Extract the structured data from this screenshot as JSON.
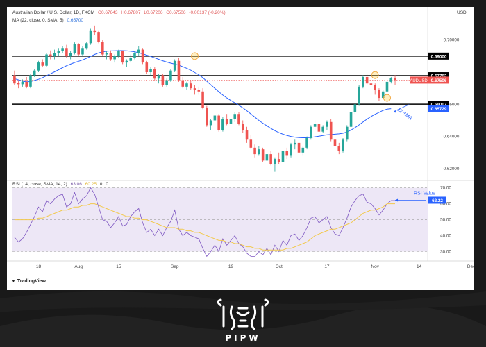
{
  "header": {
    "symbol": "Australian Dollar / U.S. Dollar, 1D, FXCM",
    "o": "O0.67643",
    "h": "H0.67807",
    "l": "L0.67206",
    "c": "C0.67506",
    "chg": "-0.00137 (-0.20%)",
    "ma_label": "MA (22, close, 0, SMA, 5)",
    "ma_value": "0.65700",
    "rsi_label": "RSI (14, close, SMA, 14, 2)",
    "rsi_value": "63.06",
    "rsi_ma_value": "60.25",
    "rsi_extra1": "0",
    "rsi_extra2": "0",
    "currency": "USD"
  },
  "colors": {
    "up": "#26a69a",
    "down": "#ef5350",
    "sma": "#2962ff",
    "rsi": "#7e57c2",
    "rsi_ma": "#f2c94c",
    "rsi_band": "#ede7f6",
    "label_black": "#000000",
    "label_red": "#ef5350",
    "label_blue": "#2962ff"
  },
  "footer": {
    "tradingview": "TradingView",
    "brand": "PIPW"
  },
  "chart_data": [
    {
      "type": "candlestick",
      "title": "Australian Dollar / U.S. Dollar, 1D, FXCM",
      "ylim": [
        0.6135,
        0.7085
      ],
      "y_ticks": [
        "0.70000",
        "0.66000",
        "0.64000",
        "0.62000"
      ],
      "x_ticks": [
        "18",
        "Aug",
        "15",
        "Sep",
        "19",
        "Oct",
        "17",
        "Nov",
        "14",
        "Dec"
      ],
      "levels": [
        {
          "value": 0.69,
          "label": "0.69000",
          "style": "black"
        },
        {
          "value": 0.67782,
          "label": "0.67782",
          "style": "black"
        },
        {
          "value": 0.66007,
          "label": "0.66007",
          "style": "black"
        }
      ],
      "price_label": {
        "value": 0.67506,
        "label": "0.67506",
        "name": "AUDUSD"
      },
      "sma_label": {
        "value": 0.65729,
        "label": "0.65729",
        "annotation": "22 SMA"
      },
      "candles": [
        [
          0.678,
          0.681,
          0.672,
          0.673
        ],
        [
          0.6735,
          0.6745,
          0.67,
          0.6725
        ],
        [
          0.6725,
          0.6755,
          0.671,
          0.674
        ],
        [
          0.674,
          0.677,
          0.67,
          0.671
        ],
        [
          0.671,
          0.679,
          0.67,
          0.678
        ],
        [
          0.678,
          0.682,
          0.677,
          0.681
        ],
        [
          0.681,
          0.687,
          0.68,
          0.686
        ],
        [
          0.686,
          0.688,
          0.683,
          0.684
        ],
        [
          0.684,
          0.692,
          0.683,
          0.691
        ],
        [
          0.691,
          0.6935,
          0.688,
          0.69
        ],
        [
          0.69,
          0.694,
          0.688,
          0.692
        ],
        [
          0.692,
          0.695,
          0.69,
          0.693
        ],
        [
          0.693,
          0.696,
          0.692,
          0.695
        ],
        [
          0.695,
          0.697,
          0.689,
          0.69
        ],
        [
          0.69,
          0.693,
          0.688,
          0.692
        ],
        [
          0.692,
          0.6985,
          0.691,
          0.6975
        ],
        [
          0.6975,
          0.698,
          0.69,
          0.691
        ],
        [
          0.691,
          0.696,
          0.69,
          0.695
        ],
        [
          0.695,
          0.699,
          0.694,
          0.698
        ],
        [
          0.698,
          0.707,
          0.697,
          0.706
        ],
        [
          0.706,
          0.709,
          0.703,
          0.705
        ],
        [
          0.705,
          0.706,
          0.698,
          0.699
        ],
        [
          0.699,
          0.7,
          0.69,
          0.691
        ],
        [
          0.691,
          0.693,
          0.688,
          0.692
        ],
        [
          0.692,
          0.6935,
          0.687,
          0.688
        ],
        [
          0.688,
          0.691,
          0.686,
          0.69
        ],
        [
          0.69,
          0.694,
          0.689,
          0.693
        ],
        [
          0.693,
          0.6935,
          0.685,
          0.686
        ],
        [
          0.686,
          0.688,
          0.683,
          0.687
        ],
        [
          0.687,
          0.691,
          0.686,
          0.689
        ],
        [
          0.689,
          0.693,
          0.688,
          0.692
        ],
        [
          0.692,
          0.696,
          0.69,
          0.694
        ],
        [
          0.694,
          0.695,
          0.685,
          0.686
        ],
        [
          0.686,
          0.687,
          0.679,
          0.68
        ],
        [
          0.68,
          0.683,
          0.678,
          0.682
        ],
        [
          0.682,
          0.683,
          0.675,
          0.676
        ],
        [
          0.676,
          0.679,
          0.673,
          0.678
        ],
        [
          0.678,
          0.679,
          0.671,
          0.672
        ],
        [
          0.672,
          0.676,
          0.671,
          0.675
        ],
        [
          0.675,
          0.682,
          0.674,
          0.681
        ],
        [
          0.681,
          0.688,
          0.68,
          0.687
        ],
        [
          0.687,
          0.689,
          0.674,
          0.675
        ],
        [
          0.675,
          0.677,
          0.67,
          0.671
        ],
        [
          0.671,
          0.674,
          0.669,
          0.673
        ],
        [
          0.673,
          0.675,
          0.669,
          0.67
        ],
        [
          0.67,
          0.672,
          0.666,
          0.669
        ],
        [
          0.669,
          0.671,
          0.666,
          0.668
        ],
        [
          0.668,
          0.67,
          0.657,
          0.658
        ],
        [
          0.658,
          0.659,
          0.646,
          0.647
        ],
        [
          0.647,
          0.651,
          0.644,
          0.65
        ],
        [
          0.65,
          0.654,
          0.648,
          0.653
        ],
        [
          0.653,
          0.654,
          0.643,
          0.644
        ],
        [
          0.644,
          0.652,
          0.643,
          0.651
        ],
        [
          0.651,
          0.654,
          0.647,
          0.648
        ],
        [
          0.648,
          0.652,
          0.646,
          0.651
        ],
        [
          0.651,
          0.655,
          0.649,
          0.654
        ],
        [
          0.654,
          0.655,
          0.647,
          0.648
        ],
        [
          0.648,
          0.65,
          0.642,
          0.644
        ],
        [
          0.644,
          0.646,
          0.636,
          0.638
        ],
        [
          0.638,
          0.641,
          0.632,
          0.633
        ],
        [
          0.633,
          0.635,
          0.627,
          0.629
        ],
        [
          0.629,
          0.634,
          0.628,
          0.632
        ],
        [
          0.632,
          0.633,
          0.624,
          0.625
        ],
        [
          0.625,
          0.63,
          0.623,
          0.629
        ],
        [
          0.629,
          0.631,
          0.622,
          0.623
        ],
        [
          0.623,
          0.627,
          0.618,
          0.626
        ],
        [
          0.626,
          0.63,
          0.623,
          0.624
        ],
        [
          0.624,
          0.632,
          0.623,
          0.631
        ],
        [
          0.631,
          0.633,
          0.626,
          0.628
        ],
        [
          0.628,
          0.636,
          0.627,
          0.635
        ],
        [
          0.635,
          0.638,
          0.632,
          0.636
        ],
        [
          0.636,
          0.637,
          0.629,
          0.63
        ],
        [
          0.63,
          0.634,
          0.628,
          0.633
        ],
        [
          0.633,
          0.64,
          0.632,
          0.639
        ],
        [
          0.639,
          0.647,
          0.638,
          0.646
        ],
        [
          0.646,
          0.65,
          0.644,
          0.648
        ],
        [
          0.648,
          0.649,
          0.642,
          0.643
        ],
        [
          0.643,
          0.647,
          0.642,
          0.646
        ],
        [
          0.646,
          0.65,
          0.644,
          0.649
        ],
        [
          0.649,
          0.651,
          0.637,
          0.638
        ],
        [
          0.638,
          0.64,
          0.633,
          0.634
        ],
        [
          0.634,
          0.636,
          0.629,
          0.631
        ],
        [
          0.631,
          0.639,
          0.63,
          0.638
        ],
        [
          0.638,
          0.647,
          0.637,
          0.646
        ],
        [
          0.646,
          0.656,
          0.645,
          0.655
        ],
        [
          0.655,
          0.661,
          0.654,
          0.66
        ],
        [
          0.66,
          0.672,
          0.659,
          0.671
        ],
        [
          0.671,
          0.678,
          0.67,
          0.677
        ],
        [
          0.677,
          0.679,
          0.672,
          0.673
        ],
        [
          0.673,
          0.674,
          0.668,
          0.672
        ],
        [
          0.672,
          0.673,
          0.666,
          0.669
        ],
        [
          0.669,
          0.67,
          0.662,
          0.664
        ],
        [
          0.664,
          0.669,
          0.663,
          0.668
        ],
        [
          0.668,
          0.675,
          0.667,
          0.674
        ],
        [
          0.674,
          0.677,
          0.673,
          0.6765
        ],
        [
          0.6765,
          0.6781,
          0.6721,
          0.6751
        ]
      ],
      "sma": [
        0.676,
        0.6752,
        0.6744,
        0.674,
        0.6742,
        0.6748,
        0.6756,
        0.6766,
        0.6778,
        0.679,
        0.6802,
        0.6815,
        0.6828,
        0.684,
        0.685,
        0.686,
        0.6868,
        0.6876,
        0.6886,
        0.6898,
        0.691,
        0.692,
        0.6926,
        0.693,
        0.6932,
        0.6933,
        0.6934,
        0.6934,
        0.6933,
        0.693,
        0.6926,
        0.6921,
        0.6914,
        0.6906,
        0.6898,
        0.6889,
        0.688,
        0.6871,
        0.6863,
        0.6856,
        0.685,
        0.6843,
        0.6834,
        0.6824,
        0.6812,
        0.6798,
        0.6784,
        0.6766,
        0.6744,
        0.6722,
        0.67,
        0.6678,
        0.6658,
        0.664,
        0.6624,
        0.6609,
        0.6594,
        0.6578,
        0.656,
        0.654,
        0.652,
        0.65,
        0.6482,
        0.6466,
        0.645,
        0.6436,
        0.6424,
        0.6414,
        0.6406,
        0.64,
        0.6396,
        0.6393,
        0.6392,
        0.6392,
        0.6394,
        0.6398,
        0.6402,
        0.6406,
        0.641,
        0.6412,
        0.6414,
        0.6416,
        0.642,
        0.6428,
        0.644,
        0.6455,
        0.6472,
        0.649,
        0.6508,
        0.6524,
        0.6538,
        0.655,
        0.6562,
        0.657,
        0.6573
      ]
    },
    {
      "type": "line",
      "title": "RSI (14, close, SMA, 14, 2)",
      "ylim": [
        25,
        72
      ],
      "y_ticks": [
        "70.00",
        "60.00",
        "50.00",
        "40.00",
        "30.00"
      ],
      "band": [
        30,
        70
      ],
      "midline": 50,
      "rsi_label": {
        "value": 62.22,
        "label": "62.22",
        "annotation": "RSI Value"
      },
      "series": [
        {
          "name": "RSI",
          "values": [
            39,
            36,
            38,
            42,
            47,
            52,
            58,
            55,
            62,
            60,
            63,
            65,
            66,
            58,
            60,
            67,
            60,
            63,
            65,
            70,
            66,
            58,
            50,
            49,
            45,
            48,
            52,
            46,
            47,
            52,
            55,
            57,
            48,
            42,
            44,
            40,
            44,
            40,
            45,
            49,
            56,
            44,
            40,
            42,
            40,
            39,
            38,
            32,
            27,
            30,
            34,
            30,
            38,
            34,
            37,
            40,
            35,
            33,
            29,
            27,
            27,
            30,
            28,
            32,
            28,
            34,
            30,
            37,
            34,
            40,
            41,
            37,
            40,
            45,
            51,
            52,
            48,
            50,
            52,
            45,
            41,
            40,
            45,
            51,
            58,
            62,
            65,
            66,
            61,
            60,
            57,
            53,
            56,
            60,
            62,
            62
          ]
        },
        {
          "name": "RSI-MA",
          "values": [
            50,
            50,
            50,
            50,
            50,
            50,
            51,
            51,
            52,
            53,
            54,
            55,
            56,
            56,
            57,
            58,
            58,
            59,
            59,
            60,
            60,
            59,
            58,
            57,
            56,
            55,
            54,
            53,
            52,
            52,
            51,
            51,
            50,
            50,
            49,
            48,
            47,
            46,
            45,
            45,
            45,
            44,
            44,
            43,
            43,
            42,
            42,
            41,
            40,
            39,
            38,
            37,
            37,
            36,
            36,
            35,
            35,
            34,
            33,
            33,
            32,
            32,
            31,
            31,
            31,
            31,
            31,
            31,
            32,
            32,
            33,
            34,
            35,
            36,
            38,
            40,
            41,
            42,
            43,
            44,
            44,
            45,
            46,
            47,
            48,
            50,
            52,
            54,
            55,
            56,
            56,
            57,
            58,
            60,
            60,
            60
          ]
        }
      ]
    }
  ]
}
